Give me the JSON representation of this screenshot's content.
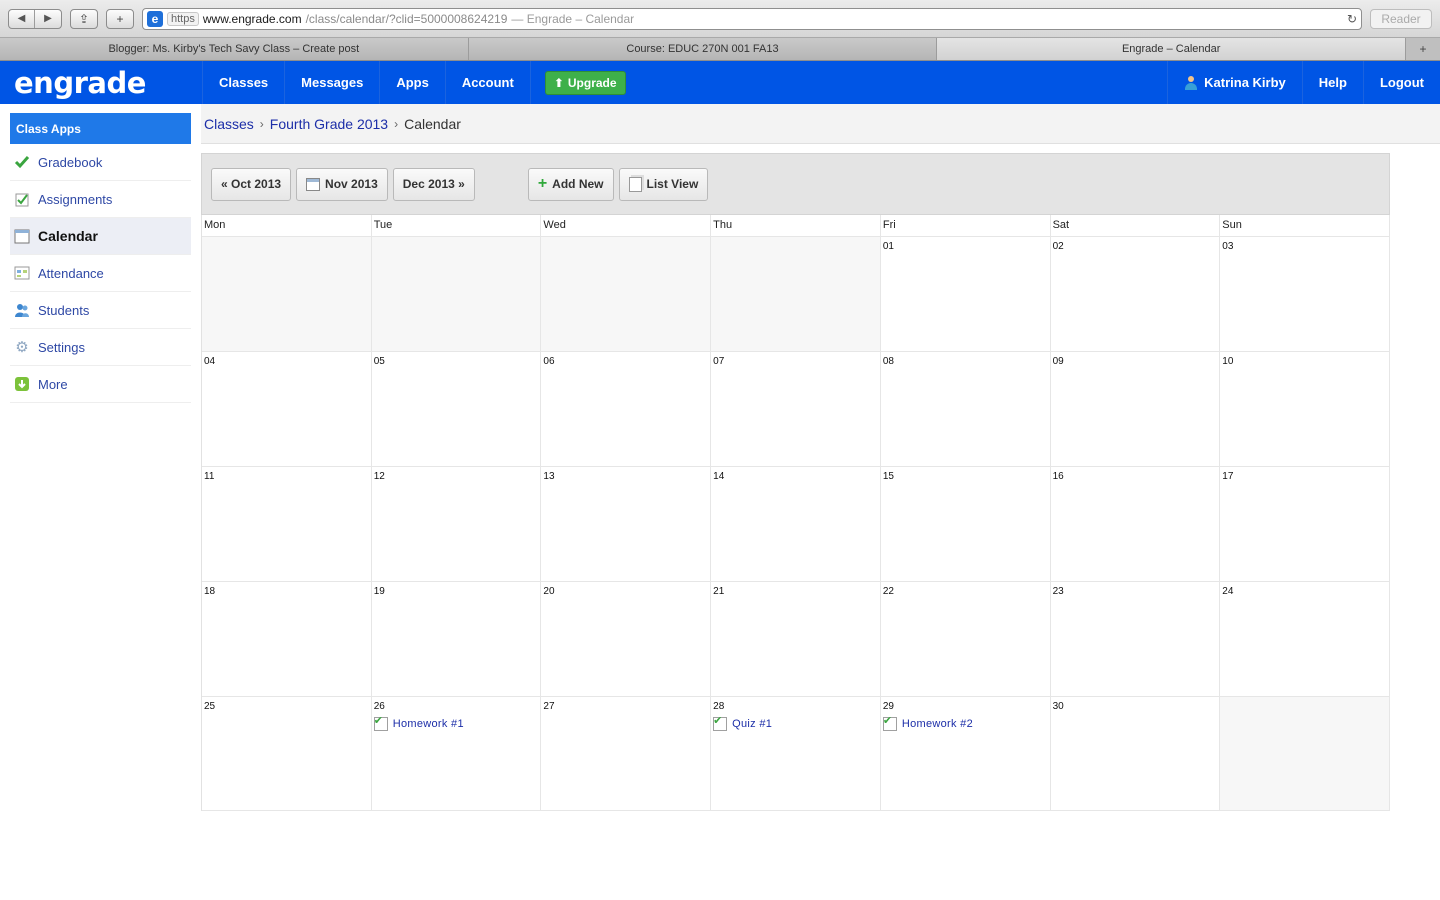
{
  "browser": {
    "url_https": "https",
    "url_host": "www.engrade.com",
    "url_path": "/class/calendar/?clid=5000008624219",
    "url_title": "— Engrade – Calendar",
    "reader_label": "Reader",
    "tabs": [
      {
        "label": "Blogger: Ms. Kirby's Tech Savy Class – Create post"
      },
      {
        "label": "Course: EDUC 270N 001 FA13"
      },
      {
        "label": "Engrade – Calendar"
      }
    ]
  },
  "header": {
    "logo": "engrade",
    "nav": [
      "Classes",
      "Messages",
      "Apps",
      "Account"
    ],
    "upgrade_label": "Upgrade",
    "user_name": "Katrina Kirby",
    "help_label": "Help",
    "logout_label": "Logout",
    "colors": {
      "brand": "#0055e5",
      "upgrade": "#3eb04a"
    }
  },
  "sidebar": {
    "heading": "Class Apps",
    "items": [
      {
        "label": "Gradebook",
        "icon": "check-icon"
      },
      {
        "label": "Assignments",
        "icon": "assignment-icon"
      },
      {
        "label": "Calendar",
        "icon": "calendar-icon",
        "active": true
      },
      {
        "label": "Attendance",
        "icon": "attendance-icon"
      },
      {
        "label": "Students",
        "icon": "students-icon"
      },
      {
        "label": "Settings",
        "icon": "gear-icon"
      },
      {
        "label": "More",
        "icon": "download-icon"
      }
    ]
  },
  "breadcrumb": {
    "items": [
      "Classes",
      "Fourth Grade 2013"
    ],
    "current": "Calendar"
  },
  "toolbar": {
    "prev_label": "« Oct 2013",
    "current_label": "Nov 2013",
    "next_label": "Dec 2013 »",
    "add_label": "Add New",
    "list_label": "List View"
  },
  "calendar": {
    "weekdays": [
      "Mon",
      "Tue",
      "Wed",
      "Thu",
      "Fri",
      "Sat",
      "Sun"
    ],
    "weeks": [
      [
        "",
        "",
        "",
        "",
        "01",
        "02",
        "03"
      ],
      [
        "04",
        "05",
        "06",
        "07",
        "08",
        "09",
        "10"
      ],
      [
        "11",
        "12",
        "13",
        "14",
        "15",
        "16",
        "17"
      ],
      [
        "18",
        "19",
        "20",
        "21",
        "22",
        "23",
        "24"
      ],
      [
        "25",
        "26",
        "27",
        "28",
        "29",
        "30",
        ""
      ]
    ],
    "events": {
      "26": [
        "Homework #1"
      ],
      "28": [
        "Quiz #1"
      ],
      "29": [
        "Homework #2"
      ]
    }
  }
}
